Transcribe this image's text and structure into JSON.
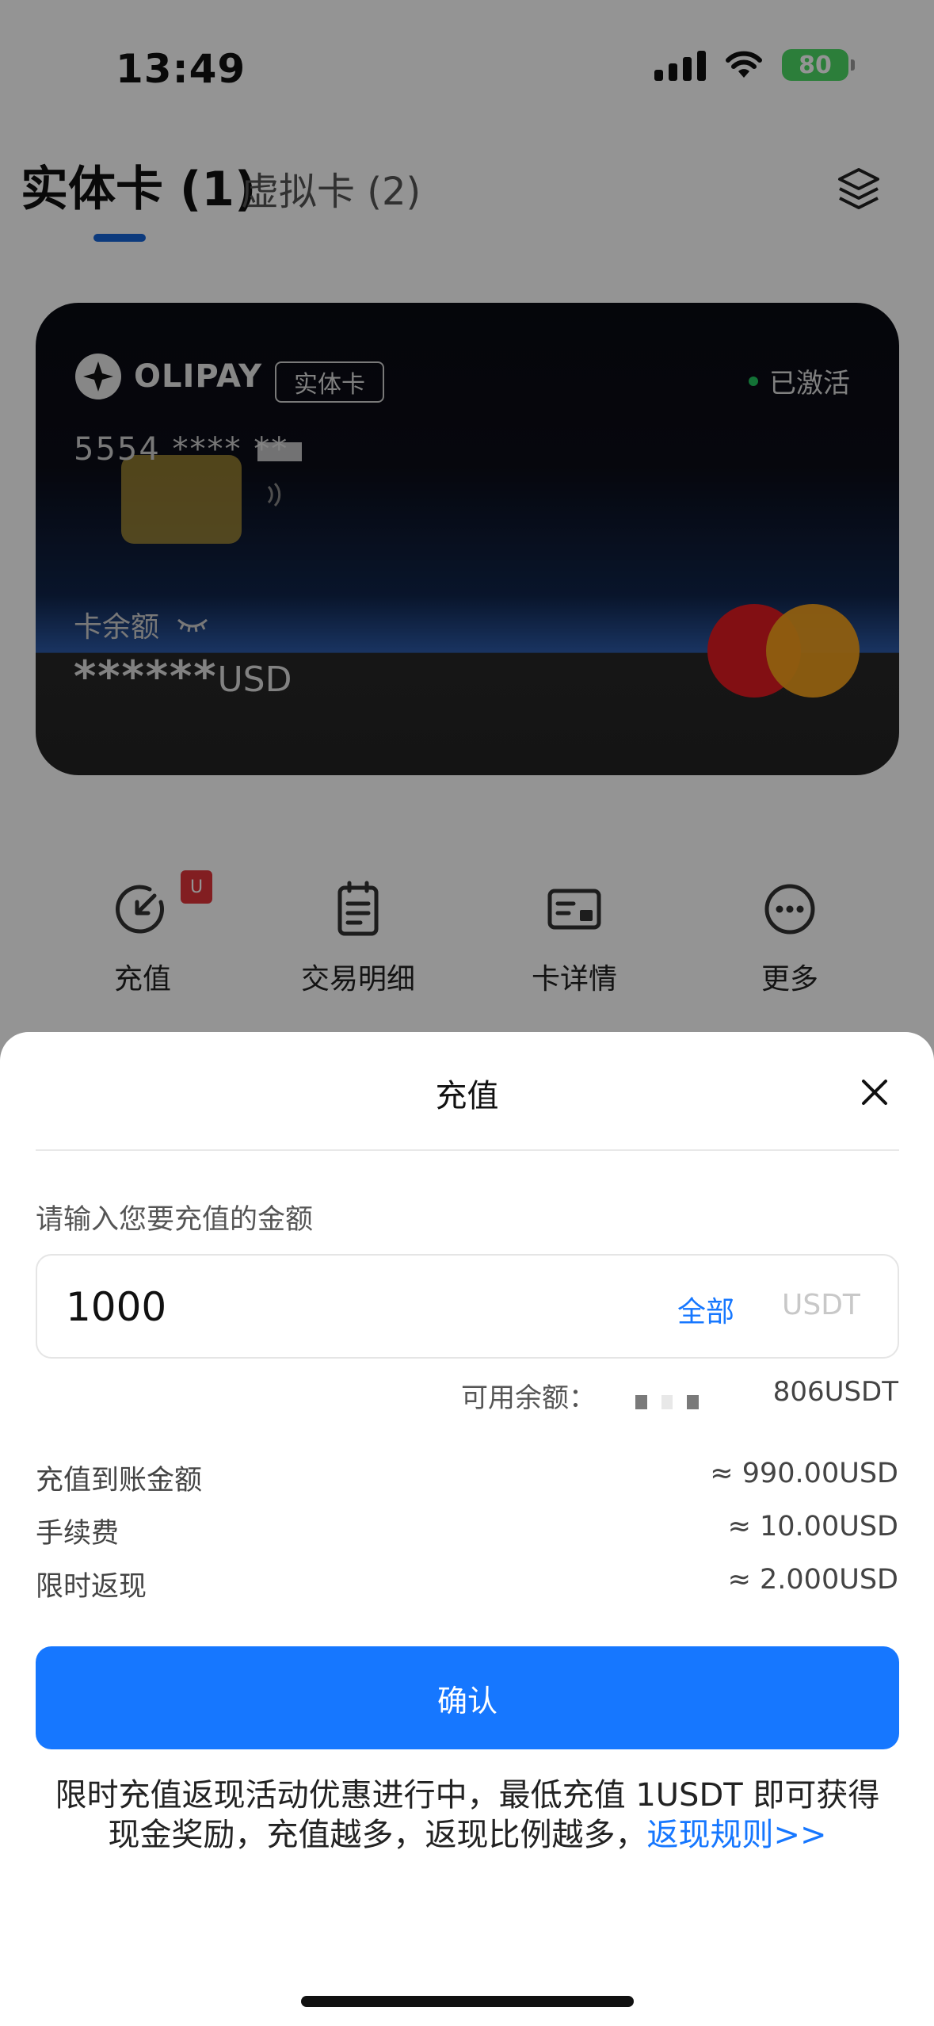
{
  "status_bar": {
    "time": "13:49",
    "battery": "80"
  },
  "tabs": [
    {
      "label": "实体卡 (1)"
    },
    {
      "label": "虚拟卡 (2)"
    }
  ],
  "card": {
    "brand": "OLIPAY",
    "type_badge": "实体卡",
    "status": "已激活",
    "number": "5554 **** **",
    "balance_label": "卡余额",
    "balance_masked": "******",
    "currency": "USD"
  },
  "quick_actions": [
    {
      "label": "充值",
      "icon": "recharge-icon"
    },
    {
      "label": "交易明细",
      "icon": "receipt-icon"
    },
    {
      "label": "卡详情",
      "icon": "card-details-icon"
    },
    {
      "label": "更多",
      "icon": "more-icon"
    }
  ],
  "recharge_sheet": {
    "title": "充值",
    "prompt": "请输入您要充值的金额",
    "amount": "1000",
    "all_label": "全部",
    "unit": "USDT",
    "available_label": "可用余额：",
    "available_value": "806USDT",
    "rows": [
      {
        "label": "充值到账金额",
        "value": "≈ 990.00USD"
      },
      {
        "label": "手续费",
        "value": "≈ 10.00USD"
      },
      {
        "label": "限时返现",
        "value": "≈ 2.000USD"
      }
    ],
    "confirm_label": "确认",
    "promo_line1": "限时充值返现活动优惠进行中，最低充值 1USDT 即可获得",
    "promo_line2": "现金奖励，充值越多，返现比例越多，",
    "promo_link": "返现规则>>"
  },
  "colors": {
    "accent": "#1677ff",
    "tab_indicator": "#1565d8",
    "active_dot": "#22c55e"
  }
}
